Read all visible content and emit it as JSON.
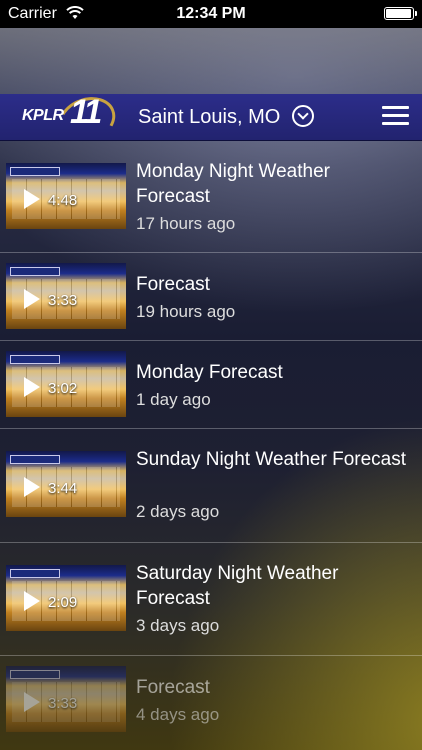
{
  "status_bar": {
    "carrier": "Carrier",
    "time": "12:34 PM",
    "battery_level": 1.0
  },
  "nav": {
    "logo_text": "KPLR",
    "logo_number": "11",
    "location": "Saint Louis, MO"
  },
  "videos": [
    {
      "title": "Monday Night Weather Forecast",
      "time_ago": "17 hours ago",
      "duration": "4:48"
    },
    {
      "title": "Forecast",
      "time_ago": "19 hours ago",
      "duration": "3:33"
    },
    {
      "title": "Monday Forecast",
      "time_ago": "1 day ago",
      "duration": "3:02"
    },
    {
      "title": "Sunday Night Weather Forecast",
      "time_ago": "2 days ago",
      "duration": "3:44"
    },
    {
      "title": "Saturday Night Weather Forecast",
      "time_ago": "3 days ago",
      "duration": "2:09"
    },
    {
      "title": "Forecast",
      "time_ago": "4 days ago",
      "duration": "3:33"
    }
  ]
}
